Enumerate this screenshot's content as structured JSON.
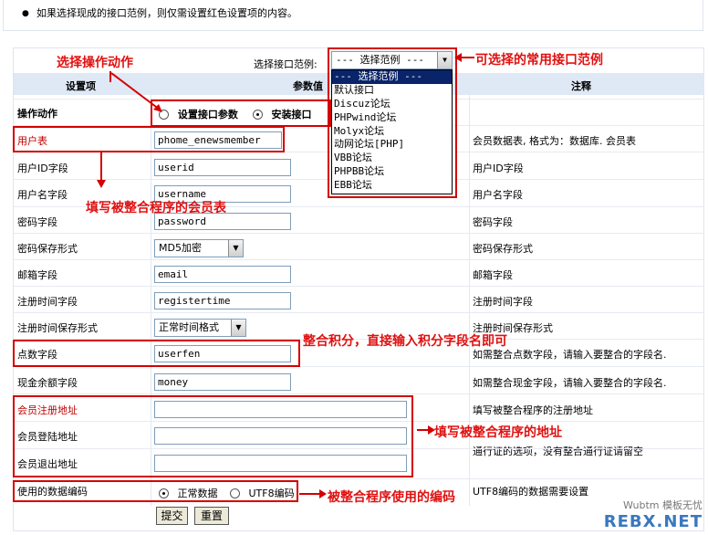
{
  "notice": {
    "bullet": "●",
    "text": "如果选择现成的接口范例，则仅需设置红色设置项的内容。"
  },
  "range": {
    "label": "选择接口范例:",
    "selected": "--- 选择范例 ---",
    "options": [
      "--- 选择范例 ---",
      "默认接口",
      "Discuz论坛",
      "PHPwind论坛",
      "Molyx论坛",
      "动网论坛[PHP]",
      "VBB论坛",
      "PHPBB论坛",
      "EBB论坛"
    ]
  },
  "headers": {
    "setting": "设置项",
    "value": "参数值",
    "note": "注释"
  },
  "action": {
    "label": "操作动作",
    "opt1": "设置接口参数",
    "opt2": "安装接口"
  },
  "rows": [
    {
      "label": "用户表",
      "value": "phome_enewsmember",
      "note": "会员数据表, 格式为：数据库. 会员表"
    },
    {
      "label": "用户ID字段",
      "value": "userid",
      "note": "用户ID字段"
    },
    {
      "label": "用户名字段",
      "value": "username",
      "note": "用户名字段"
    },
    {
      "label": "密码字段",
      "value": "password",
      "note": "密码字段"
    },
    {
      "label": "密码保存形式",
      "value": "MD5加密",
      "note": "密码保存形式"
    },
    {
      "label": "邮箱字段",
      "value": "email",
      "note": "邮箱字段"
    },
    {
      "label": "注册时间字段",
      "value": "registertime",
      "note": "注册时间字段"
    },
    {
      "label": "注册时间保存形式",
      "value": "正常时间格式",
      "note": "注册时间保存形式"
    },
    {
      "label": "点数字段",
      "value": "userfen",
      "note": "如需整合点数字段，请输入要整合的字段名."
    },
    {
      "label": "现金余额字段",
      "value": "money",
      "note": "如需整合现金字段，请输入要整合的字段名."
    },
    {
      "label": "会员注册地址",
      "value": "",
      "note": "填写被整合程序的注册地址"
    },
    {
      "label": "会员登陆地址",
      "value": "",
      "note": "通行证的选项，没有整合通行证请留空"
    },
    {
      "label": "会员退出地址",
      "value": "",
      "note": ""
    }
  ],
  "encoding": {
    "label": "使用的数据编码",
    "opt1": "正常数据",
    "opt2": "UTF8编码",
    "note": "UTF8编码的数据需要设置"
  },
  "buttons": {
    "submit": "提交",
    "reset": "重置"
  },
  "annotations": {
    "choose_action": "选择操作动作",
    "common_examples": "可选择的常用接口范例",
    "member_table": "填写被整合程序的会员表",
    "points": "整合积分，直接输入积分字段名即可",
    "address": "填写被整合程序的地址",
    "encoding": "被整合程序使用的编码"
  },
  "watermark": {
    "top": "Wubtm 模板无忧",
    "main": "REBX.NET"
  },
  "colors": {
    "annotation": "#d40000",
    "header_bg": "#dfe8f5",
    "label_red": "#c00000"
  }
}
